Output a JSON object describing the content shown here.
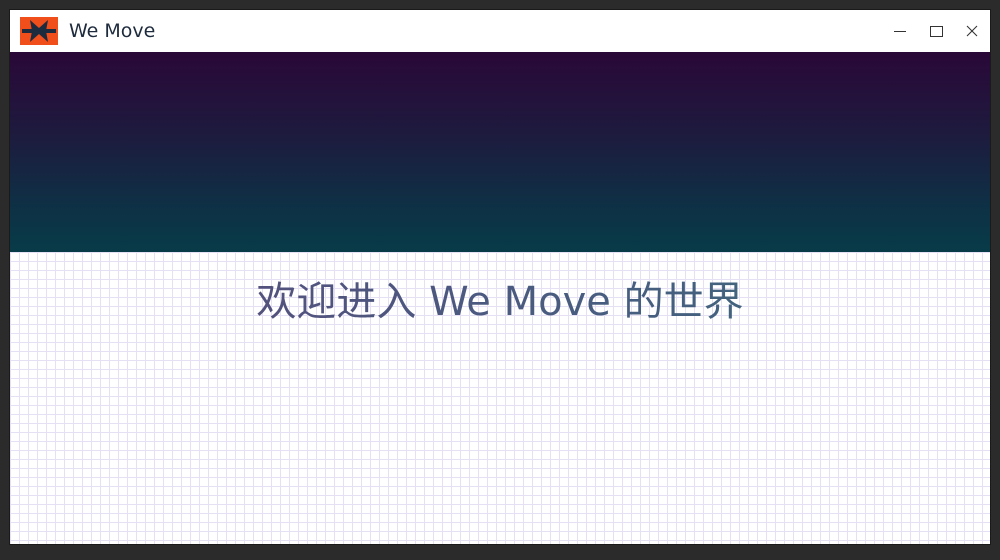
{
  "window": {
    "title": "We Move",
    "controls": {
      "minimize_icon": "minimize-icon",
      "maximize_icon": "maximize-icon",
      "close_icon": "close-icon"
    }
  },
  "colors": {
    "logo_background": "#f04e1a",
    "logo_mark": "#1d2b3f",
    "hero_top": "#2a0838",
    "hero_bottom": "#073b48",
    "grid_line": "#e6e0f5",
    "welcome_text": "#4a5578"
  },
  "main": {
    "welcome_text": "欢迎进入 We Move 的世界"
  }
}
